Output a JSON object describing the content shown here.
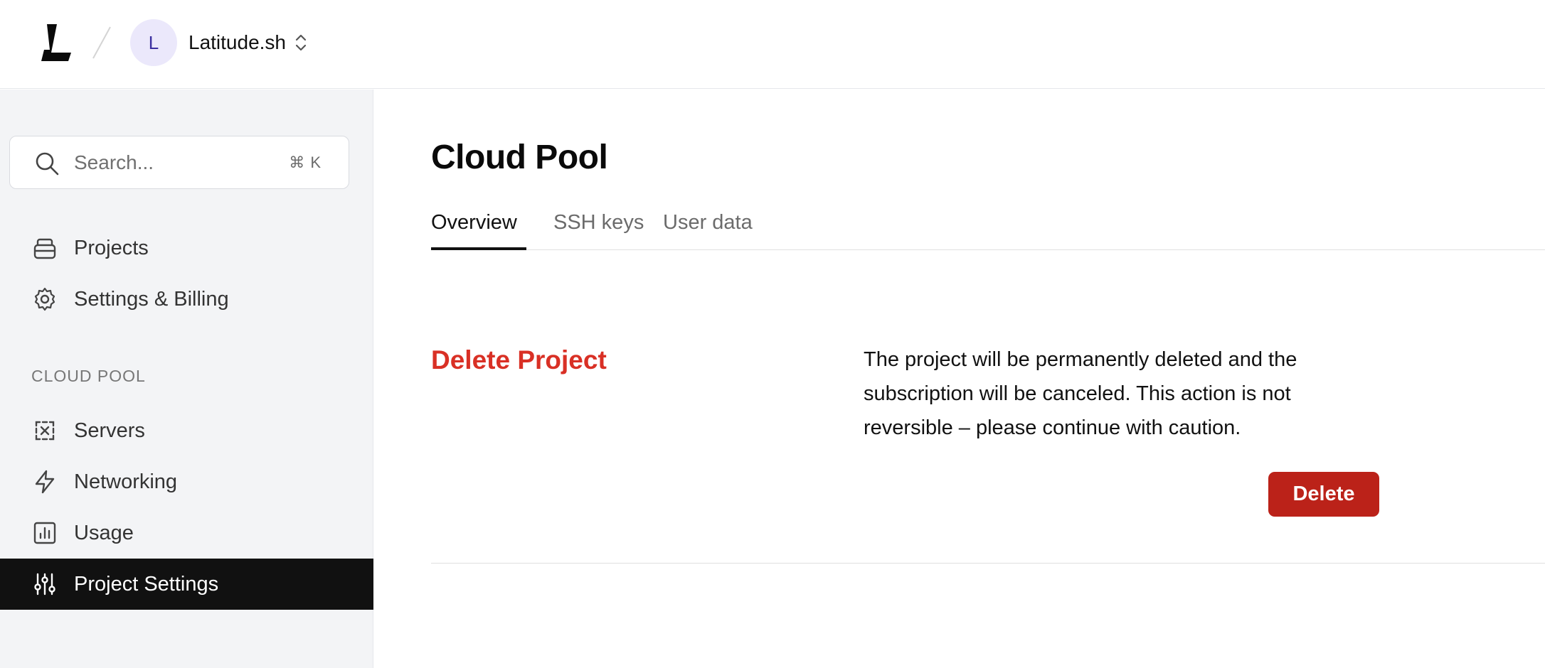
{
  "header": {
    "org_avatar_letter": "L",
    "org_name": "Latitude.sh"
  },
  "sidebar": {
    "search": {
      "placeholder": "Search...",
      "shortcut": "⌘ K"
    },
    "items": [
      {
        "label": "Projects",
        "icon": "projects-icon"
      },
      {
        "label": "Settings & Billing",
        "icon": "gear-icon"
      }
    ],
    "section_label": "CLOUD POOL",
    "section_items": [
      {
        "label": "Servers",
        "icon": "servers-icon"
      },
      {
        "label": "Networking",
        "icon": "lightning-icon"
      },
      {
        "label": "Usage",
        "icon": "bar-chart-icon"
      },
      {
        "label": "Project Settings",
        "icon": "sliders-icon",
        "active": true
      }
    ]
  },
  "main": {
    "title": "Cloud Pool",
    "tabs": [
      {
        "label": "Overview",
        "active": true
      },
      {
        "label": "SSH keys"
      },
      {
        "label": "User data"
      }
    ],
    "danger": {
      "title": "Delete Project",
      "description": "The project will be permanently deleted and the subscription will be canceled. This action is not reversible – please continue with caution.",
      "button_label": "Delete"
    }
  },
  "colors": {
    "danger_text": "#d93025",
    "danger_button": "#bb2219",
    "active_nav_bg": "#111111",
    "avatar_bg": "#ebe8fb"
  }
}
